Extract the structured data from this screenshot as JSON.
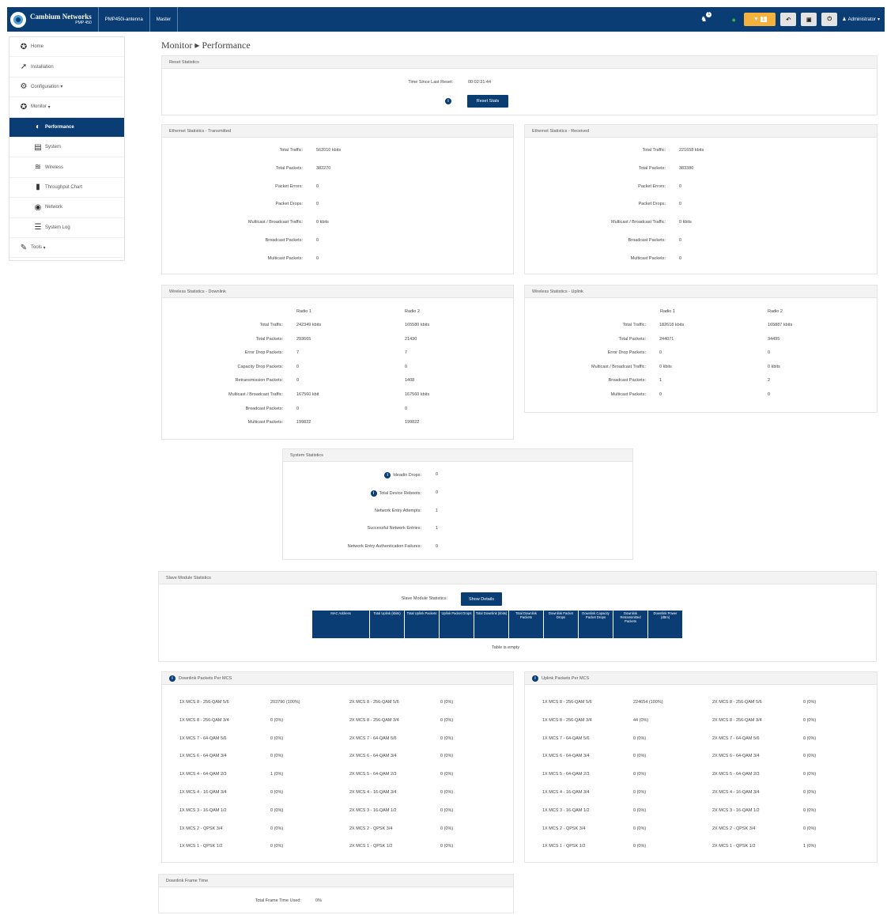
{
  "topbar": {
    "brand": "Cambium Networks",
    "brand_sub": "PMP 450",
    "crumb1": "PMP450i-antenna",
    "crumb2": "Master",
    "alert_count": "1",
    "warn_count": "1",
    "user": "Administrator"
  },
  "sidebar": {
    "items": [
      {
        "label": "Home",
        "icon": "home-icon"
      },
      {
        "label": "Installation",
        "icon": "installation-icon"
      },
      {
        "label": "Configuration",
        "icon": "gear-icon"
      },
      {
        "label": "Monitor",
        "icon": "monitor-icon"
      },
      {
        "label": "Performance",
        "icon": "gauge-icon"
      },
      {
        "label": "System",
        "icon": "system-icon"
      },
      {
        "label": "Wireless",
        "icon": "wifi-icon"
      },
      {
        "label": "Throughput Chart",
        "icon": "chart-icon"
      },
      {
        "label": "Network",
        "icon": "globe-icon"
      },
      {
        "label": "System Log",
        "icon": "list-icon"
      },
      {
        "label": "Tools",
        "icon": "wrench-icon"
      }
    ]
  },
  "page": {
    "title": "Monitor",
    "subtitle": "Performance"
  },
  "reset": {
    "title": "Reset Statistics",
    "label": "Time Since Last Reset:",
    "value": "00:02:31:44",
    "button": "Reset Stats"
  },
  "eth_tx": {
    "title": "Ethernet Statistics - Transmitted",
    "rows": [
      [
        "Total Traffic:",
        "562010 kbits"
      ],
      [
        "Total Packets:",
        "382270"
      ],
      [
        "Packet Errors:",
        "0"
      ],
      [
        "Packet Drops:",
        "0"
      ],
      [
        "Multicast / Broadcast Traffic:",
        "0 kbits"
      ],
      [
        "Broadcast Packets:",
        "0"
      ],
      [
        "Multicast Packets:",
        "0"
      ]
    ]
  },
  "eth_rx": {
    "title": "Ethernet Statistics - Received",
    "rows": [
      [
        "Total Traffic:",
        "221658 kbits"
      ],
      [
        "Total Packets:",
        "383380"
      ],
      [
        "Packet Errors:",
        "0"
      ],
      [
        "Packet Drops:",
        "0"
      ],
      [
        "Multicast / Broadcast Traffic:",
        "0 kbits"
      ],
      [
        "Broadcast Packets:",
        "0"
      ],
      [
        "Multicast Packets:",
        "0"
      ]
    ]
  },
  "wl_dn": {
    "title": "Wireless Statistics - Downlink",
    "headers": [
      "Radio 1",
      "Radio 2"
    ],
    "rows": [
      [
        "Total Traffic:",
        "242349 kbits",
        "165580 kbits"
      ],
      [
        "Total Packets:",
        "293665",
        "21430"
      ],
      [
        "Error Drop Packets:",
        "7",
        "7"
      ],
      [
        "Capacity Drop Packets:",
        "0",
        "0"
      ],
      [
        "Retransmission Packets:",
        "0",
        "1408"
      ],
      [
        "Multicast / Broadcast Traffic:",
        "167560 kbit",
        "167560 kbits"
      ],
      [
        "Broadcast Packets:",
        "0",
        "0"
      ],
      [
        "Multicast Packets:",
        "199822",
        "199822"
      ]
    ]
  },
  "wl_up": {
    "title": "Wireless Statistics - Uplink",
    "headers": [
      "Radio 1",
      "Radio 2"
    ],
    "rows": [
      [
        "Total Traffic:",
        "182618 kbits",
        "165887 kbits"
      ],
      [
        "Total Packets:",
        "244071",
        "34495"
      ],
      [
        "Error Drop Packets:",
        "0",
        "0"
      ],
      [
        "Multicast / Broadcast Traffic:",
        "0 kbits",
        "0 kbits"
      ],
      [
        "Broadcast Packets:",
        "1",
        "2"
      ],
      [
        "Multicast Packets:",
        "0",
        "0"
      ]
    ]
  },
  "sys": {
    "title": "System Statistics",
    "rows": [
      [
        "Ideadin Drops:",
        "0",
        true
      ],
      [
        "Total Device Reboots:",
        "0",
        true
      ],
      [
        "Network Entry Attempts:",
        "1",
        false
      ],
      [
        "Successful Network Entries:",
        "1",
        false
      ],
      [
        "Network Entry Authentication Failures:",
        "0",
        false
      ]
    ]
  },
  "slave": {
    "title": "Slave Module Statistics",
    "label": "Slave Module Statistics:",
    "button": "Show Details",
    "columns": [
      "MAC Address",
      "Total Uplink (kbits)",
      "Total Uplink Packets",
      "Uplink Packet Drops",
      "Total Downlink (kbits)",
      "Total Downlink Packets",
      "Downlink Packet Drops",
      "Downlink Capacity Packet Drops",
      "Downlink Retransmitted Packets",
      "Downlink Power (dBm)"
    ],
    "empty": "Table is empty"
  },
  "mcs_dn": {
    "title": "Downlink Packets Per MCS",
    "left": [
      [
        "1X MCS 8 - 256-QAM 5/6",
        "203790 (100%)"
      ],
      [
        "1X MCS 8 - 256-QAM 3/4",
        "0 (0%)"
      ],
      [
        "1X MCS 7 - 64-QAM 5/6",
        "0 (0%)"
      ],
      [
        "1X MCS 6 - 64-QAM 3/4",
        "0 (0%)"
      ],
      [
        "1X MCS 4 - 64-QAM 2/3",
        "1 (0%)"
      ],
      [
        "1X MCS 4 - 16-QAM 3/4",
        "0 (0%)"
      ],
      [
        "1X MCS 3 - 16-QAM 1/2",
        "0 (0%)"
      ],
      [
        "1X MCS 2 - QPSK 3/4",
        "0 (0%)"
      ],
      [
        "1X MCS 1 - QPSK 1/2",
        "0 (0%)"
      ]
    ],
    "right": [
      [
        "2X MCS 8 - 256-QAM 5/6",
        "0 (0%)"
      ],
      [
        "2X MCS 8 - 256-QAM 3/4",
        "0 (0%)"
      ],
      [
        "2X MCS 7 - 64-QAM 5/6",
        "0 (0%)"
      ],
      [
        "2X MCS 6 - 64-QAM 3/4",
        "0 (0%)"
      ],
      [
        "2X MCS 5 - 64-QAM 2/3",
        "0 (0%)"
      ],
      [
        "2X MCS 4 - 16-QAM 3/4",
        "0 (0%)"
      ],
      [
        "2X MCS 3 - 16-QAM 1/2",
        "0 (0%)"
      ],
      [
        "2X MCS 2 - QPSK 3/4",
        "0 (0%)"
      ],
      [
        "2X MCS 1 - QPSK 1/2",
        "0 (0%)"
      ]
    ]
  },
  "mcs_up": {
    "title": "Uplink Packets Per MCS",
    "left": [
      [
        "1X MCS 8 - 256-QAM 5/6",
        "224654 (100%)"
      ],
      [
        "1X MCS 8 - 256-QAM 3/4",
        "44 (0%)"
      ],
      [
        "1X MCS 7 - 64-QAM 5/6",
        "0 (0%)"
      ],
      [
        "1X MCS 6 - 64-QAM 3/4",
        "0 (0%)"
      ],
      [
        "1X MCS 5 - 64-QAM 2/3",
        "0 (0%)"
      ],
      [
        "1X MCS 4 - 16-QAM 3/4",
        "0 (0%)"
      ],
      [
        "1X MCS 3 - 16-QAM 1/2",
        "0 (0%)"
      ],
      [
        "1X MCS 2 - QPSK 3/4",
        "0 (0%)"
      ],
      [
        "1X MCS 1 - QPSK 1/2",
        "0 (0%)"
      ]
    ],
    "right": [
      [
        "2X MCS 8 - 256-QAM 5/6",
        "0 (0%)"
      ],
      [
        "2X MCS 8 - 256-QAM 3/4",
        "0 (0%)"
      ],
      [
        "2X MCS 7 - 64-QAM 5/6",
        "0 (0%)"
      ],
      [
        "2X MCS 6 - 64-QAM 3/4",
        "0 (0%)"
      ],
      [
        "2X MCS 5 - 64-QAM 2/3",
        "0 (0%)"
      ],
      [
        "2X MCS 4 - 16-QAM 3/4",
        "0 (0%)"
      ],
      [
        "2X MCS 3 - 16-QAM 1/2",
        "0 (0%)"
      ],
      [
        "2X MCS 2 - QPSK 3/4",
        "0 (0%)"
      ],
      [
        "2X MCS 1 - QPSK 1/2",
        "1 (0%)"
      ]
    ]
  },
  "frame": {
    "title": "Downlink Frame Time",
    "label": "Total Frame Time Used:",
    "value": "0%"
  }
}
